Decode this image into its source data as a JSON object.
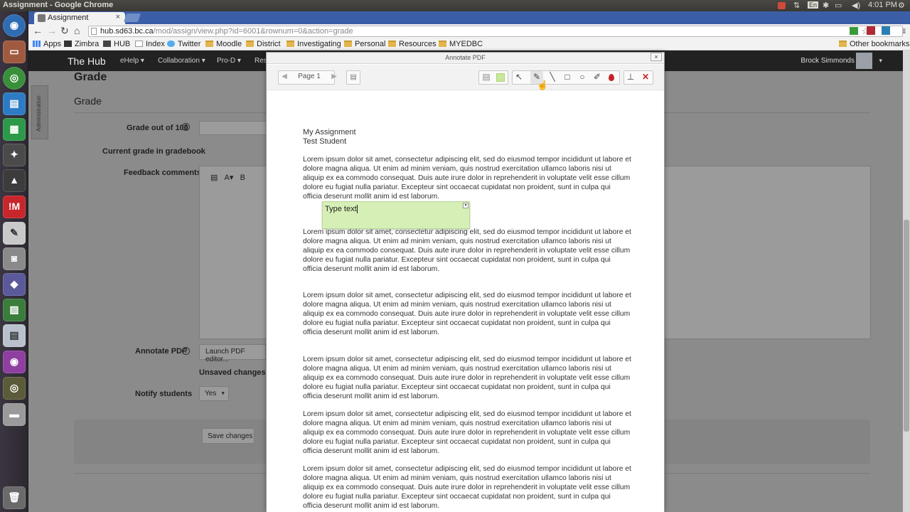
{
  "topbar": {
    "title": "Assignment - Google Chrome",
    "lang": "En",
    "time": "4:01 PM"
  },
  "browser": {
    "tab_title": "Assignment",
    "tab_close": "×",
    "url_host": "hub.sd63.bc.ca",
    "url_path": "/mod/assign/view.php?id=6001&rownum=0&action=grade",
    "nav": {
      "back": "←",
      "forward": "→",
      "reload": "↻",
      "home": "⌂",
      "menu": "≡",
      "star": "☆"
    }
  },
  "bookmarks": [
    {
      "label": "Apps",
      "icon": "apps-icon"
    },
    {
      "label": "Zimbra",
      "icon": "zimbra-icon"
    },
    {
      "label": "HUB",
      "icon": "hub-icon"
    },
    {
      "label": "Index",
      "icon": "page-icon"
    },
    {
      "label": "Twitter",
      "icon": "twitter-icon"
    },
    {
      "label": "Moodle",
      "icon": "folder-icon"
    },
    {
      "label": "District",
      "icon": "folder-icon"
    },
    {
      "label": "Investigating",
      "icon": "folder-icon"
    },
    {
      "label": "Personal",
      "icon": "folder-icon"
    },
    {
      "label": "Resources",
      "icon": "folder-icon"
    },
    {
      "label": "MYEDBC",
      "icon": "folder-icon"
    }
  ],
  "other_bookmarks": "Other bookmarks",
  "moodle_nav": {
    "brand": "The Hub",
    "items": [
      "eHelp ▾",
      "Collaboration ▾",
      "Pro-D ▾",
      "Res"
    ],
    "user": "Brock Simmonds"
  },
  "background": {
    "heading": "Grade",
    "subheading": "Grade",
    "admin_tab": "Administration",
    "grade_label": "Grade out of 100",
    "current_grade_label": "Current grade in gradebook",
    "current_grade_value": "-",
    "feedback_label": "Feedback comments",
    "annotate_label": "Annotate PDF",
    "launch_button": "Launch PDF editor...",
    "unsaved": "Unsaved changes",
    "notify_label": "Notify students",
    "notify_value": "Yes",
    "save_button": "Save changes"
  },
  "dialog": {
    "title": "Annotate PDF",
    "close": "×",
    "page_label": "Page 1",
    "prev": "◀",
    "next": "▶",
    "tools": [
      {
        "name": "comment-search-icon",
        "glyph": "▤"
      },
      {
        "name": "color-swatch-icon",
        "glyph": ""
      },
      {
        "name": "select-pointer-icon",
        "glyph": "↖"
      },
      {
        "name": "comment-tool-icon",
        "glyph": "✎"
      },
      {
        "name": "line-tool-icon",
        "glyph": "╲"
      },
      {
        "name": "rectangle-tool-icon",
        "glyph": "□"
      },
      {
        "name": "oval-tool-icon",
        "glyph": "○"
      },
      {
        "name": "pen-tool-icon",
        "glyph": "✐"
      },
      {
        "name": "highlight-color-icon",
        "glyph": "💧"
      },
      {
        "name": "stamp-tool-icon",
        "glyph": "⊥"
      },
      {
        "name": "delete-tool-icon",
        "glyph": "✕"
      }
    ]
  },
  "pdf": {
    "line1": "My Assignment",
    "line2": "Test Student",
    "lorem": "Lorem ipsum dolor sit amet, consectetur adipiscing elit, sed do eiusmod tempor incididunt ut labore et dolore magna aliqua. Ut enim ad minim veniam, quis nostrud exercitation ullamco laboris nisi ut aliquip ex ea commodo consequat. Duis aute irure dolor in reprehenderit in voluptate velit esse cillum dolore eu fugiat nulla pariatur. Excepteur sint occaecat cupidatat non proident, sunt in culpa qui officia deserunt mollit anim id est laborum.",
    "comment_text": "Type text"
  }
}
